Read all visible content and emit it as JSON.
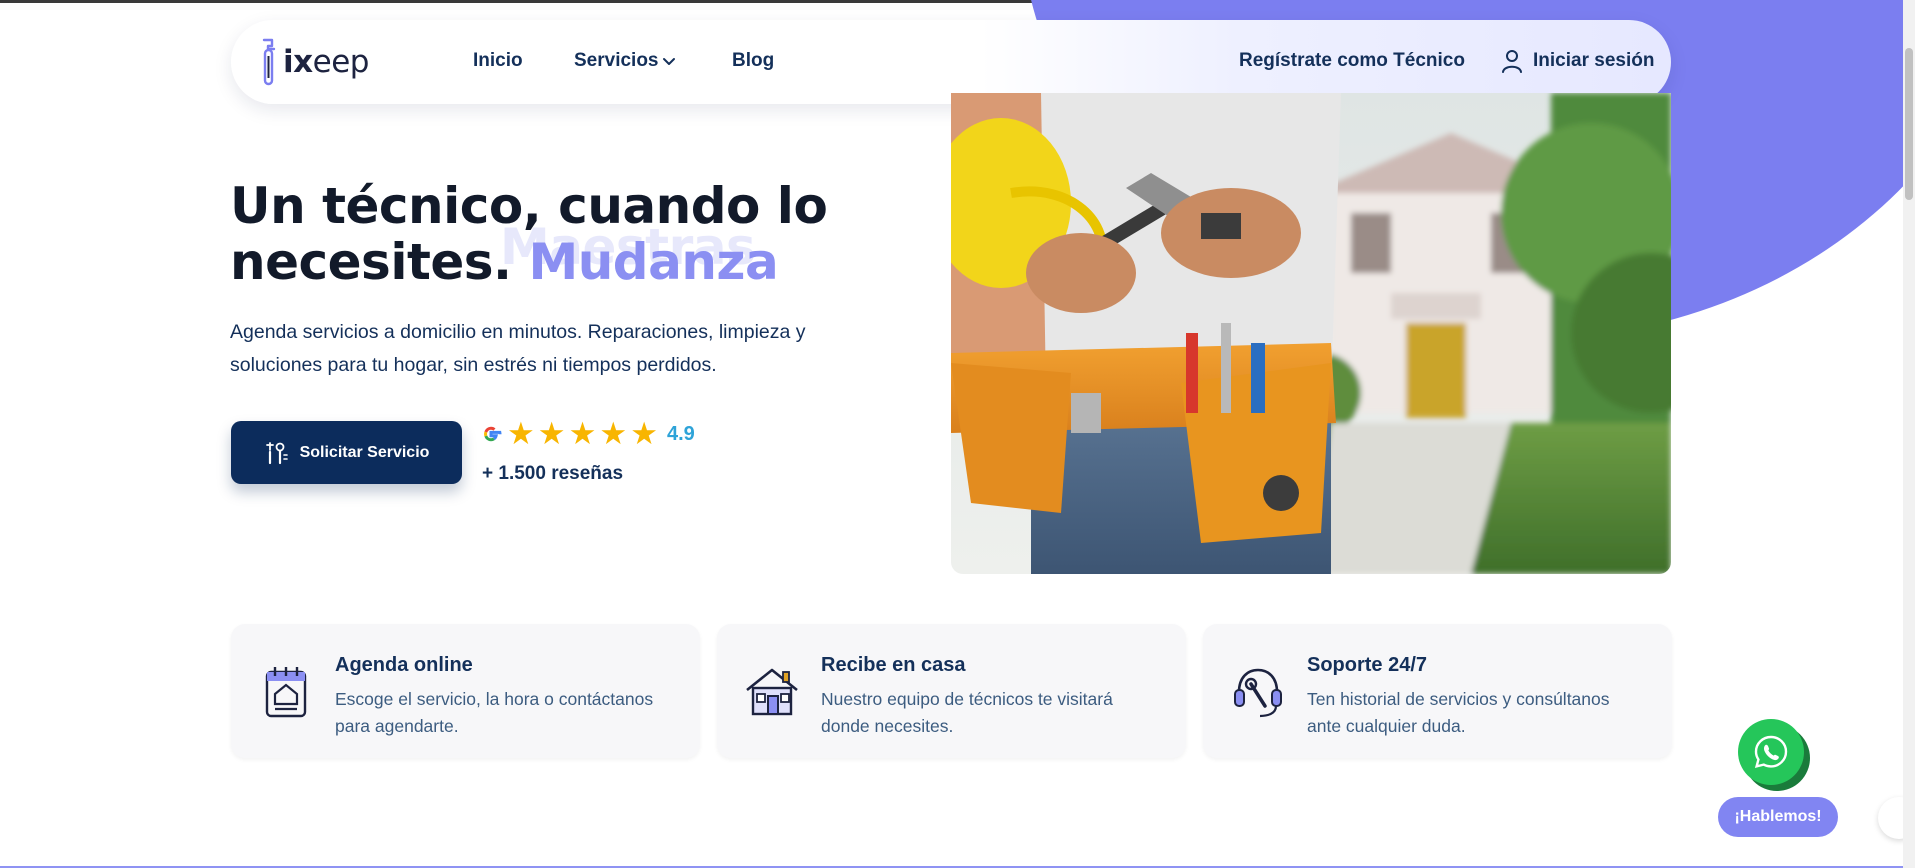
{
  "brand": {
    "logo_bold": "ix",
    "logo_rest": "eep"
  },
  "nav": {
    "inicio": "Inicio",
    "servicios": "Servicios",
    "blog": "Blog",
    "register_tech": "Regístrate como Técnico",
    "login": "Iniciar sesión"
  },
  "hero": {
    "title_line1": "Un técnico, cuando lo",
    "title_line2": "necesites.",
    "rotating_word": "Mudanza",
    "ghost_word": "Maestras",
    "subtitle": "Agenda servicios a domicilio en minutos. Reparaciones, limpieza y soluciones para tu hogar, sin estrés ni tiempos perdidos.",
    "cta_label": "Solicitar Servicio"
  },
  "rating": {
    "stars": 5,
    "value": "4.9",
    "reviews": "+ 1.500 reseñas"
  },
  "features": [
    {
      "title": "Agenda online",
      "description": "Escoge el servicio, la hora o contáctanos para agendarte.",
      "icon": "calendar-icon"
    },
    {
      "title": "Recibe en casa",
      "description": "Nuestro equipo de técnicos te visitará donde necesites.",
      "icon": "house-icon"
    },
    {
      "title": "Soporte 24/7",
      "description": "Ten historial de servicios y consúltanos ante cualquier duda.",
      "icon": "support-icon"
    }
  ],
  "chat": {
    "label": "¡Hablemos!"
  },
  "colors": {
    "primary": "#0c2c5c",
    "accent": "#7b7ef0",
    "star": "#f8b500",
    "rating": "#2ea3d8",
    "whatsapp": "#25c65a"
  }
}
